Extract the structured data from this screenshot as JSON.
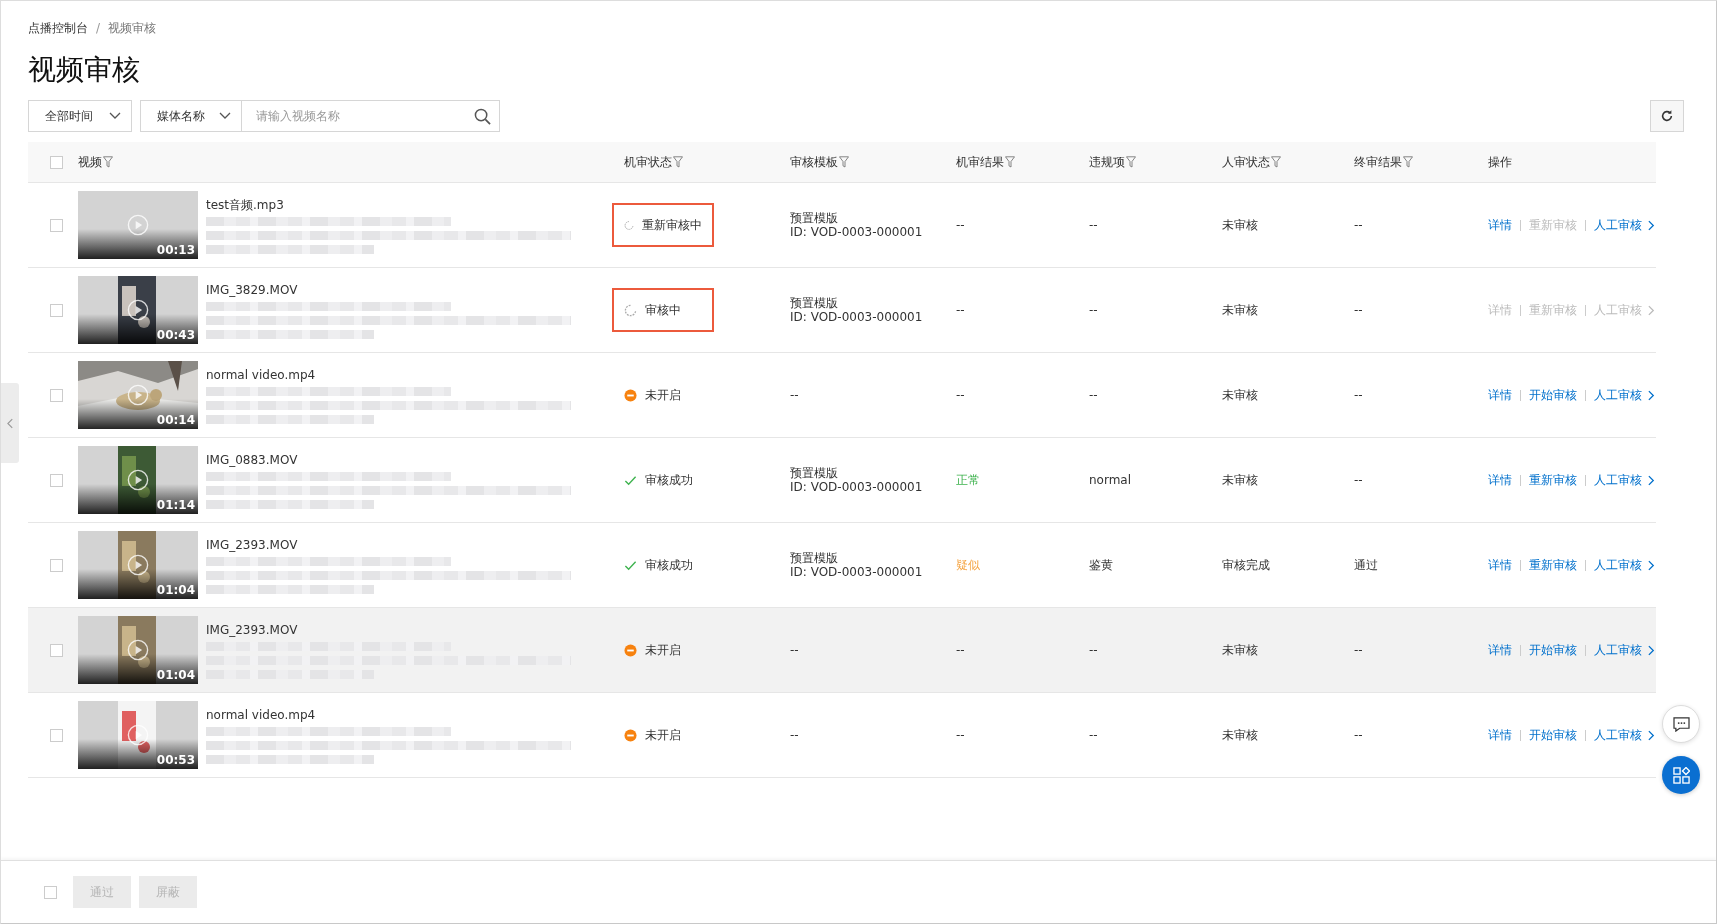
{
  "breadcrumb": {
    "items": [
      "点播控制台",
      "视频审核"
    ],
    "separator": "/"
  },
  "title": "视频审核",
  "toolbar": {
    "time_select": "全部时间",
    "field_select": "媒体名称",
    "search": {
      "placeholder": "请输入视频名称"
    }
  },
  "table": {
    "select_all": {
      "checked": false
    },
    "columns": [
      {
        "label": "视频",
        "filter": true
      },
      {
        "label": "机审状态",
        "filter": true
      },
      {
        "label": "审核模板",
        "filter": true
      },
      {
        "label": "机审结果",
        "filter": true
      },
      {
        "label": "违规项",
        "filter": true
      },
      {
        "label": "人审状态",
        "filter": true
      },
      {
        "label": "终审结果",
        "filter": true
      },
      {
        "label": "操作",
        "filter": false
      }
    ],
    "rows": [
      {
        "checked": false,
        "hover": false,
        "duration": "00:13",
        "name": "test音频.mp3",
        "status": {
          "kind": "loading",
          "text": "重新审核中",
          "flagged": true
        },
        "template": [
          "预置模版",
          "ID: VOD-0003-000001"
        ],
        "machine_result": {
          "text": "--"
        },
        "violation": "--",
        "human_status": "未审核",
        "final_result": "--",
        "actions": [
          {
            "label": "详情",
            "disabled": false
          },
          {
            "label": "重新审核",
            "disabled": true
          },
          {
            "label": "人工审核",
            "disabled": false
          }
        ]
      },
      {
        "checked": false,
        "hover": false,
        "duration": "00:43",
        "name": "IMG_3829.MOV",
        "status": {
          "kind": "loading",
          "text": "审核中",
          "flagged": true
        },
        "template": [
          "预置模版",
          "ID: VOD-0003-000001"
        ],
        "machine_result": {
          "text": "--"
        },
        "violation": "--",
        "human_status": "未审核",
        "final_result": "--",
        "actions": [
          {
            "label": "详情",
            "disabled": true
          },
          {
            "label": "重新审核",
            "disabled": true
          },
          {
            "label": "人工审核",
            "disabled": true
          }
        ]
      },
      {
        "checked": false,
        "hover": false,
        "duration": "00:14",
        "name": "normal video.mp4",
        "status": {
          "kind": "off",
          "text": "未开启",
          "flagged": false
        },
        "template": [
          "--"
        ],
        "machine_result": {
          "text": "--"
        },
        "violation": "--",
        "human_status": "未审核",
        "final_result": "--",
        "actions": [
          {
            "label": "详情",
            "disabled": false
          },
          {
            "label": "开始审核",
            "disabled": false
          },
          {
            "label": "人工审核",
            "disabled": false
          }
        ]
      },
      {
        "checked": false,
        "hover": false,
        "duration": "01:14",
        "name": "IMG_0883.MOV",
        "status": {
          "kind": "success",
          "text": "审核成功",
          "flagged": false
        },
        "template": [
          "预置模版",
          "ID: VOD-0003-000001"
        ],
        "machine_result": {
          "text": "正常",
          "kind": "normal"
        },
        "violation": "normal",
        "human_status": "未审核",
        "final_result": "--",
        "actions": [
          {
            "label": "详情",
            "disabled": false
          },
          {
            "label": "重新审核",
            "disabled": false
          },
          {
            "label": "人工审核",
            "disabled": false
          }
        ]
      },
      {
        "checked": false,
        "hover": false,
        "duration": "01:04",
        "name": "IMG_2393.MOV",
        "status": {
          "kind": "success",
          "text": "审核成功",
          "flagged": false
        },
        "template": [
          "预置模版",
          "ID: VOD-0003-000001"
        ],
        "machine_result": {
          "text": "疑似",
          "kind": "suspect"
        },
        "violation": "鉴黄",
        "human_status": "审核完成",
        "final_result": "通过",
        "actions": [
          {
            "label": "详情",
            "disabled": false
          },
          {
            "label": "重新审核",
            "disabled": false
          },
          {
            "label": "人工审核",
            "disabled": false
          }
        ]
      },
      {
        "checked": false,
        "hover": true,
        "duration": "01:04",
        "name": "IMG_2393.MOV",
        "status": {
          "kind": "off",
          "text": "未开启",
          "flagged": false
        },
        "template": [
          "--"
        ],
        "machine_result": {
          "text": "--"
        },
        "violation": "--",
        "human_status": "未审核",
        "final_result": "--",
        "actions": [
          {
            "label": "详情",
            "disabled": false
          },
          {
            "label": "开始审核",
            "disabled": false
          },
          {
            "label": "人工审核",
            "disabled": false
          }
        ]
      },
      {
        "checked": false,
        "hover": false,
        "duration": "00:53",
        "name": "normal video.mp4",
        "status": {
          "kind": "off",
          "text": "未开启",
          "flagged": false
        },
        "template": [
          "--"
        ],
        "machine_result": {
          "text": "--"
        },
        "violation": "--",
        "human_status": "未审核",
        "final_result": "--",
        "actions": [
          {
            "label": "详情",
            "disabled": false
          },
          {
            "label": "开始审核",
            "disabled": false
          },
          {
            "label": "人工审核",
            "disabled": false
          }
        ]
      }
    ]
  },
  "footer": {
    "select_all": {
      "checked": false
    },
    "buttons": [
      {
        "label": "通过",
        "disabled": true
      },
      {
        "label": "屏蔽",
        "disabled": true
      }
    ]
  }
}
